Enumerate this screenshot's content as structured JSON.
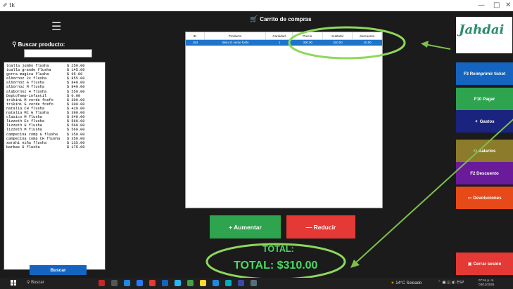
{
  "window": {
    "title_icon": "✐ tk",
    "minimize": "—",
    "maximize": "□",
    "close": "✕"
  },
  "sidebar": {
    "menu_icon": "☰",
    "search_label": "Buscar producto:",
    "search_value": "",
    "products": [
      {
        "name": "toalla jumbo flusha",
        "price": "$ 250.00"
      },
      {
        "name": "toalla grande flusha",
        "price": "$ 145.00"
      },
      {
        "name": "gorra magica flusha",
        "price": "$  95.00"
      },
      {
        "name": "albornoz 2x flusha",
        "price": "$ 855.00"
      },
      {
        "name": "albornoz G flusha",
        "price": "$ 840.00"
      },
      {
        "name": "albornoz M flusha",
        "price": "$ 840.00"
      },
      {
        "name": "alabornoz 4 flusha",
        "price": "$ 550.00"
      },
      {
        "name": "DeptoTemp-infantil",
        "price": "$   0.00"
      },
      {
        "name": "trikini M  verde fosfo",
        "price": "$ 300.00"
      },
      {
        "name": "trikini G verde fosfo",
        "price": "$ 300.00"
      },
      {
        "name": "natalia CH flusha",
        "price": "$ 420.00"
      },
      {
        "name": "natalia MC G flusha",
        "price": "$ 390.00"
      },
      {
        "name": "clasico M flusha",
        "price": "$ 340.00"
      },
      {
        "name": "lizzeth Ex flusha",
        "price": "$ 560.00"
      },
      {
        "name": "lizzeth G flusha",
        "price": "$ 560.00"
      },
      {
        "name": "lizzeth M flusha",
        "price": "$ 560.00"
      },
      {
        "name": "campecina comp G flusha",
        "price": "$ 350.00"
      },
      {
        "name": "campecina comp CH flusha",
        "price": "$ 350.00"
      },
      {
        "name": "sarahi niña flusha",
        "price": "$ 135.00"
      },
      {
        "name": "barbas G flusha",
        "price": "$ 175.00"
      }
    ],
    "search_button": "Buscar"
  },
  "cart": {
    "title": "Carrito de compras",
    "columns": [
      "ID",
      "Producto",
      "Cantidad",
      "Precio",
      "Subtotal",
      "descuento"
    ],
    "rows": [
      [
        "153",
        "trikini G verde fosfo",
        "1",
        "300.00",
        "310.00",
        "10.00"
      ]
    ],
    "add_button": "+ Aumentar",
    "reduce_button": "— Reducir",
    "total_label": "TOTAL:",
    "total_value": "TOTAL: $310.00"
  },
  "right_panel": {
    "logo_text": "Jahdai",
    "buttons": [
      {
        "label": "F3 Reimprimir ticket",
        "icon": "",
        "color": "#1565c0"
      },
      {
        "label": "F10 Pagar",
        "icon": "",
        "color": "#2ea44f"
      },
      {
        "label": "Gastos",
        "icon": "✦",
        "color": "#1a237e"
      },
      {
        "label": "Salarios",
        "icon": "⚇",
        "color": "#8b7b2a"
      },
      {
        "label": "F2 Descuento",
        "icon": "",
        "color": "#6a1b9a"
      },
      {
        "label": "Devoluciones",
        "icon": "▭",
        "color": "#e64a19"
      },
      {
        "label": "Cerrar sesión",
        "icon": "▣",
        "color": "#e53935"
      }
    ]
  },
  "taskbar": {
    "search": "Buscar",
    "weather": "14°C  Soleado",
    "tray": "⌃ ▣ ◫ ◖) ESP",
    "time": "07:44 p. m.",
    "date": "03/11/2025"
  }
}
